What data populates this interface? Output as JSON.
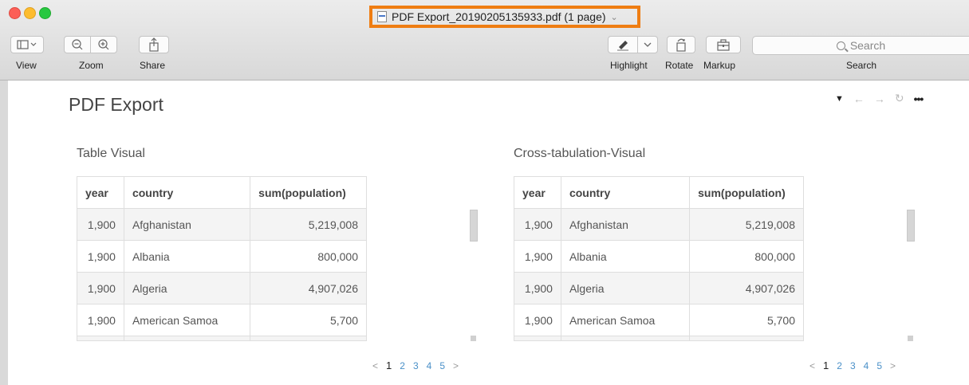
{
  "window": {
    "title": "PDF Export_20190205135933.pdf (1 page)",
    "title_chevron": "⌄"
  },
  "toolbar": {
    "view_label": "View",
    "zoom_label": "Zoom",
    "share_label": "Share",
    "highlight_label": "Highlight",
    "rotate_label": "Rotate",
    "markup_label": "Markup",
    "search_label": "Search",
    "search_placeholder": "Search"
  },
  "page": {
    "title": "PDF Export"
  },
  "visuals": [
    {
      "title": "Table Visual",
      "columns": [
        "year",
        "country",
        "sum(population)"
      ],
      "rows": [
        [
          "1,900",
          "Afghanistan",
          "5,219,008"
        ],
        [
          "1,900",
          "Albania",
          "800,000"
        ],
        [
          "1,900",
          "Algeria",
          "4,907,026"
        ],
        [
          "1,900",
          "American Samoa",
          "5,700"
        ]
      ],
      "pager": {
        "prev": "<",
        "current": "1",
        "pages": [
          "2",
          "3",
          "4",
          "5"
        ],
        "next": ">"
      }
    },
    {
      "title": "Cross-tabulation-Visual",
      "columns": [
        "year",
        "country",
        "sum(population)"
      ],
      "rows": [
        [
          "1,900",
          "Afghanistan",
          "5,219,008"
        ],
        [
          "1,900",
          "Albania",
          "800,000"
        ],
        [
          "1,900",
          "Algeria",
          "4,907,026"
        ],
        [
          "1,900",
          "American Samoa",
          "5,700"
        ]
      ],
      "pager": {
        "prev": "<",
        "current": "1",
        "pages": [
          "2",
          "3",
          "4",
          "5"
        ],
        "next": ">"
      }
    }
  ],
  "icons": {
    "funnel": "filter-icon",
    "back": "arrow-left-icon",
    "forward": "arrow-right-icon",
    "refresh": "refresh-icon",
    "more": "more-icon"
  },
  "colors": {
    "title_highlight": "#ef7d12",
    "link": "#4a90c8"
  }
}
